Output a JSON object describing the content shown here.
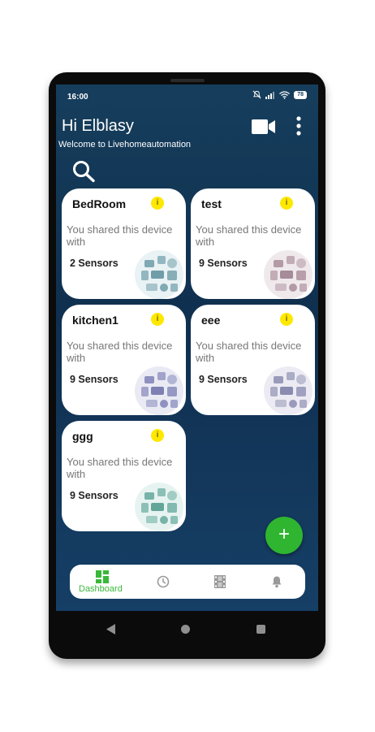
{
  "status_bar": {
    "time": "16:00",
    "battery": "78",
    "icons": [
      "mute-icon",
      "signal-icon",
      "wifi-icon",
      "battery-icon"
    ]
  },
  "header": {
    "greeting": "Hi Elblasy",
    "subtitle": "Welcome to Livehomeautomation",
    "actions": [
      "camera-icon",
      "more-vert-icon",
      "search-icon"
    ]
  },
  "devices": [
    {
      "name": "BedRoom",
      "description": "You shared this device with",
      "sensors": "2 Sensors",
      "info": "i"
    },
    {
      "name": "test",
      "description": "You shared this device with",
      "sensors": "9 Sensors",
      "info": "i"
    },
    {
      "name": "kitchen1",
      "description": "You shared this device with",
      "sensors": "9 Sensors",
      "info": "i"
    },
    {
      "name": "eee",
      "description": "You shared this device with",
      "sensors": "9 Sensors",
      "info": "i"
    },
    {
      "name": "ggg",
      "description": "You shared this device with",
      "sensors": "9 Sensors",
      "info": "i"
    }
  ],
  "fab": {
    "icon": "plus-icon",
    "label": "+"
  },
  "bottom_nav": {
    "items": [
      {
        "label": "Dashboard",
        "icon": "dashboard-icon",
        "active": true
      },
      {
        "label": "",
        "icon": "clock-icon",
        "active": false
      },
      {
        "label": "",
        "icon": "film-icon",
        "active": false
      },
      {
        "label": "",
        "icon": "bell-icon",
        "active": false
      }
    ]
  },
  "colors": {
    "background_top": "#163e5c",
    "background_bottom": "#163f66",
    "accent_green": "#39b839",
    "info_badge": "#ffe800",
    "card": "#ffffff"
  }
}
